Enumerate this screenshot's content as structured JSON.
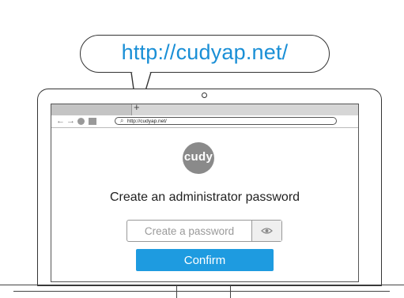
{
  "bubble": {
    "url": "http://cudyap.net/"
  },
  "browser": {
    "new_tab_glyph": "+",
    "back_glyph": "←",
    "forward_glyph": "→",
    "search_glyph": "⌕",
    "address": "http://cudyap.net/"
  },
  "page": {
    "logo_text": "cudy",
    "title": "Create an administrator password",
    "password_placeholder": "Create a password",
    "show_password_icon": "eye-icon",
    "confirm_label": "Confirm"
  },
  "colors": {
    "accent": "#1e9be0",
    "url_text": "#1a8fd6",
    "logo_bg": "#8a8a8a"
  }
}
